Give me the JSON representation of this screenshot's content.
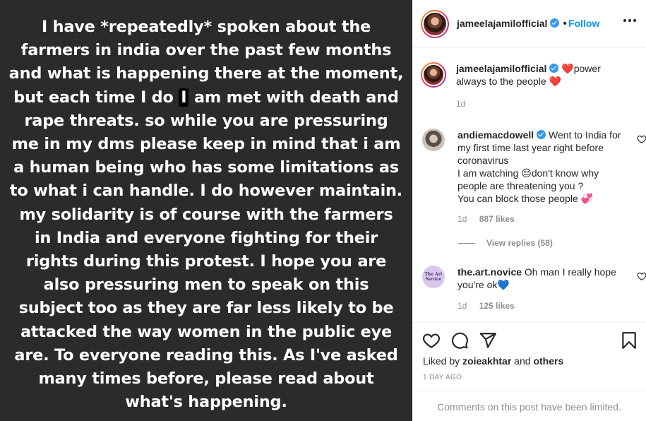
{
  "post": {
    "text_lines": [
      "I have *repeatedly* spoken about the",
      "farmers in india over the past few months",
      "and what is happening there at the moment,",
      "but each time I do ",
      "I",
      " am met with death and",
      "rape threats. so while you are pressuring",
      "me in my dms please keep in mind that i am",
      "a human being who has some limitations as",
      "to what i can handle. I do however maintain.",
      "my solidarity is of course with the farmers",
      "in India and everyone fighting for their",
      "rights during this protest. I hope you are",
      "also pressuring men to speak on this",
      "subject too as they are far less likely to be",
      "attacked the way women in the public eye",
      "are. To everyone reading this. As I've asked",
      "many times before, please read about",
      "what's happening."
    ]
  },
  "header": {
    "username": "jameelajamilofficial",
    "separator": "•",
    "follow_label": "Follow",
    "more_icon": "more-horizontal-icon"
  },
  "caption": {
    "username": "jameelajamilofficial",
    "heart": "❤️",
    "text": "power always to the people",
    "heart_end": "❤️",
    "time": "1d"
  },
  "comments": [
    {
      "username": "andiemacdowell",
      "text_1": "Went to India for my first time last year right before coronavirus",
      "text_2": "I am watching 😔don't know why people are threatening you ?",
      "text_3": "You can block those people 💞",
      "time": "1d",
      "likes": "887 likes"
    },
    {
      "username": "the.art.novice",
      "text": "Oh man I really hope you're ok💙",
      "time": "1d",
      "likes": "125 likes",
      "avatar_text": "The Art Novice"
    }
  ],
  "view_replies": "View replies (58)",
  "likes": {
    "prefix": "Liked by ",
    "user": "zoieakhtar",
    "middle": " and ",
    "others": "others"
  },
  "timestamp": "1 DAY AGO",
  "comments_limited": "Comments on this post have been limited.",
  "colors": {
    "accent": "#0095f6",
    "verified": "#3897f0",
    "media_bg": "#2b2b2b",
    "muted": "#8e8e8e"
  }
}
